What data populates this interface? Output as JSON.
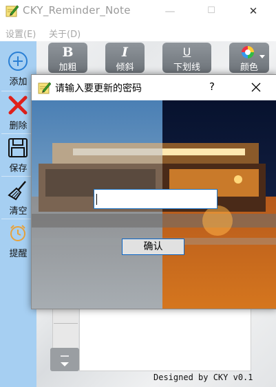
{
  "window": {
    "title": "CKY_Reminder_Note",
    "minimize": "—",
    "maximize": "☐",
    "close": "✕"
  },
  "menu": [
    {
      "label": "设置(E)"
    },
    {
      "label": "关于(D)"
    }
  ],
  "sidebar": {
    "items": [
      {
        "label": "添加",
        "icon": "add-circle-icon"
      },
      {
        "label": "删除",
        "icon": "delete-x-icon"
      },
      {
        "label": "保存",
        "icon": "floppy-save-icon"
      },
      {
        "label": "清空",
        "icon": "broom-clear-icon"
      },
      {
        "label": "提醒",
        "icon": "alarm-clock-icon"
      }
    ]
  },
  "toolbar": {
    "bold": {
      "glyph": "B",
      "label": "加粗"
    },
    "italic": {
      "glyph": "I",
      "label": "倾斜"
    },
    "underline": {
      "glyph": "U",
      "label": "下划线"
    },
    "color": {
      "label": "颜色",
      "icon": "color-wheel-icon"
    }
  },
  "footer": {
    "text": "Designed by CKY  v0.1"
  },
  "dialog": {
    "title": "请输入要更新的密码",
    "help": "?",
    "password_value": "",
    "confirm_label": "确认"
  },
  "colors": {
    "sidebar_bg": "#a6cff2",
    "toolbar_btn": "#7b8186",
    "input_border": "#1a74c8",
    "delete_red": "#e0201a",
    "add_blue": "#2a7fd4"
  }
}
